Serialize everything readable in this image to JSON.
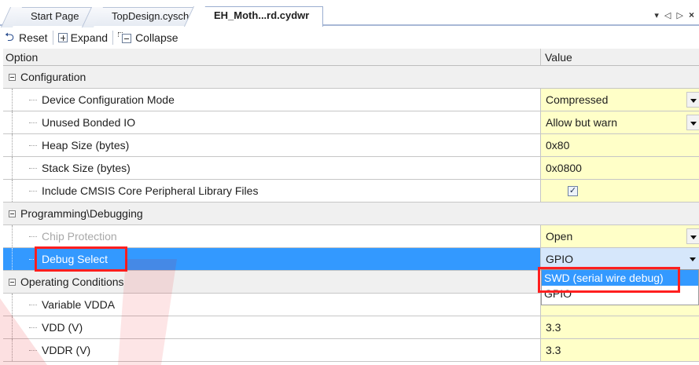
{
  "tabs": [
    {
      "label": "Start Page"
    },
    {
      "label": "TopDesign.cysch"
    },
    {
      "label": "EH_Moth...rd.cydwr"
    }
  ],
  "tab_controls": {
    "dropdown": "▾",
    "prev": "◁",
    "next": "▷",
    "close": "×"
  },
  "toolbar": {
    "reset_label": "Reset",
    "expand_label": "Expand",
    "collapse_label": "Collapse"
  },
  "grid": {
    "header": {
      "option": "Option",
      "value": "Value"
    },
    "categories": [
      {
        "label": "Configuration",
        "properties": [
          {
            "name": "Device Configuration Mode",
            "value": "Compressed"
          },
          {
            "name": "Unused Bonded IO",
            "value": "Allow but warn"
          },
          {
            "name": "Heap Size (bytes)",
            "value": "0x80"
          },
          {
            "name": "Stack Size (bytes)",
            "value": "0x0800"
          },
          {
            "name": "Include CMSIS Core Peripheral Library Files",
            "value": "✓"
          }
        ]
      },
      {
        "label": "Programming\\Debugging",
        "properties": [
          {
            "name": "Chip Protection",
            "value": "Open"
          },
          {
            "name": "Debug Select",
            "value": "GPIO"
          }
        ]
      },
      {
        "label": "Operating Conditions",
        "properties": [
          {
            "name": "Variable VDDA",
            "value": ""
          },
          {
            "name": "VDD (V)",
            "value": "3.3"
          },
          {
            "name": "VDDR (V)",
            "value": "3.3"
          }
        ]
      }
    ]
  },
  "dropdown_options": [
    {
      "label": "SWD (serial wire debug)"
    },
    {
      "label": "GPIO"
    }
  ],
  "colors": {
    "value_bg": "#ffffc8",
    "selection": "#3399ff",
    "category_bg": "#f0f0f0",
    "highlight_box": "#ff1f1f"
  }
}
